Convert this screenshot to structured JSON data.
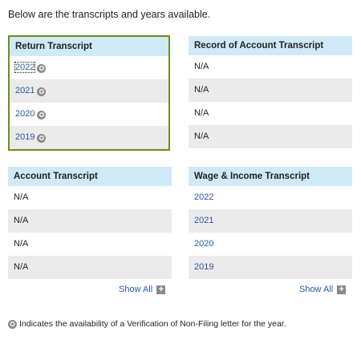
{
  "intro_text": "Below are the transcripts and years available.",
  "star_glyph": "✪",
  "return_transcript": {
    "header": "Return Transcript",
    "rows": [
      "2022",
      "2021",
      "2020",
      "2019"
    ]
  },
  "record_of_account": {
    "header": "Record of Account Transcript",
    "rows": [
      "N/A",
      "N/A",
      "N/A",
      "N/A"
    ]
  },
  "account_transcript": {
    "header": "Account Transcript",
    "rows": [
      "N/A",
      "N/A",
      "N/A",
      "N/A"
    ],
    "show_all": "Show All"
  },
  "wage_income": {
    "header": "Wage & Income Transcript",
    "rows": [
      "2022",
      "2021",
      "2020",
      "2019"
    ],
    "show_all": "Show All"
  },
  "legend_text": "Indicates the availability of a Verification of Non-Filing letter for the year.",
  "colors": {
    "header_bg": "#cfe9f7",
    "alt_row_bg": "#ebebeb",
    "link": "#2a5aa6",
    "selected_border": "#6b8e23"
  }
}
